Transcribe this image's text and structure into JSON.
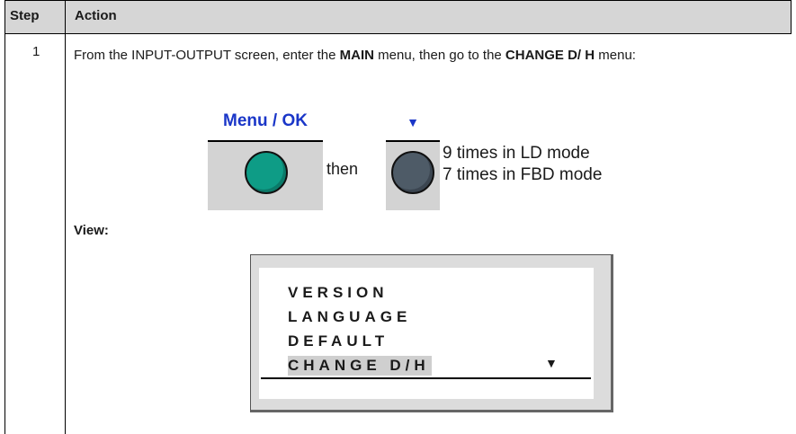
{
  "table": {
    "header_step": "Step",
    "header_action": "Action",
    "row_step": "1"
  },
  "instruction": {
    "part1": "From the INPUT-OUTPUT screen, enter the ",
    "bold1": "MAIN",
    "part2": " menu, then go to the ",
    "bold2": "CHANGE D/ H",
    "part3": " menu:"
  },
  "keys": {
    "menu_ok_label": "Menu / OK",
    "down_label": "▼",
    "menu_ok_button_color": "#0e9c86",
    "down_button_color": "#4e5b67",
    "label_color": "#1a36c8"
  },
  "connector": "then",
  "repeat": {
    "ld": "9 times in LD mode",
    "fbd": "7 times in FBD mode"
  },
  "view_label": "View:",
  "lcd_menu": {
    "items": [
      "VERSION",
      "LANGUAGE",
      "DEFAULT",
      "CHANGE D/H"
    ],
    "selected_index": 3,
    "scroll_indicator": "▼"
  }
}
